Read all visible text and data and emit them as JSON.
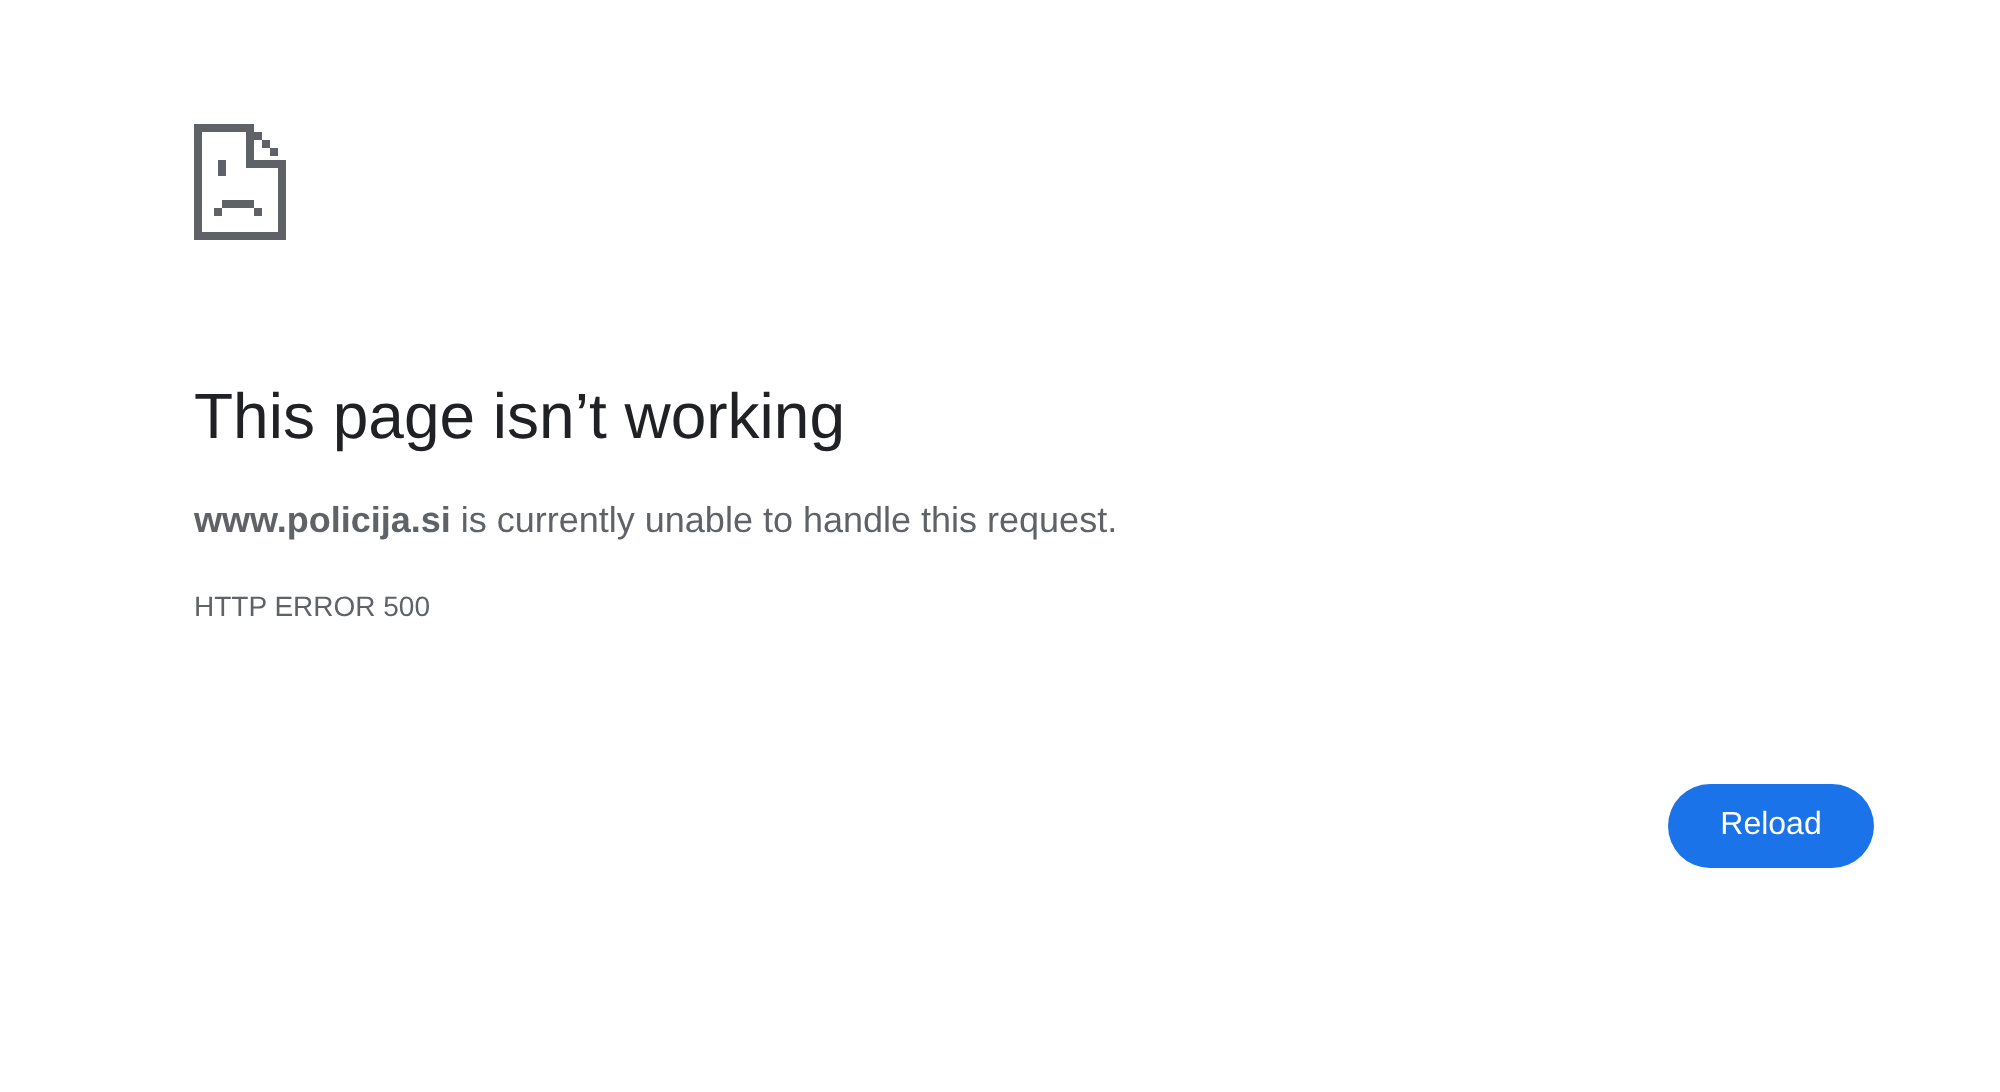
{
  "title": "This page isn’t working",
  "message": "**www.policija.si** is currently unable to handle this request.",
  "error_code": "HTTP ERROR 500",
  "buttons": [
    {
      "label": "Reload"
    }
  ]
}
